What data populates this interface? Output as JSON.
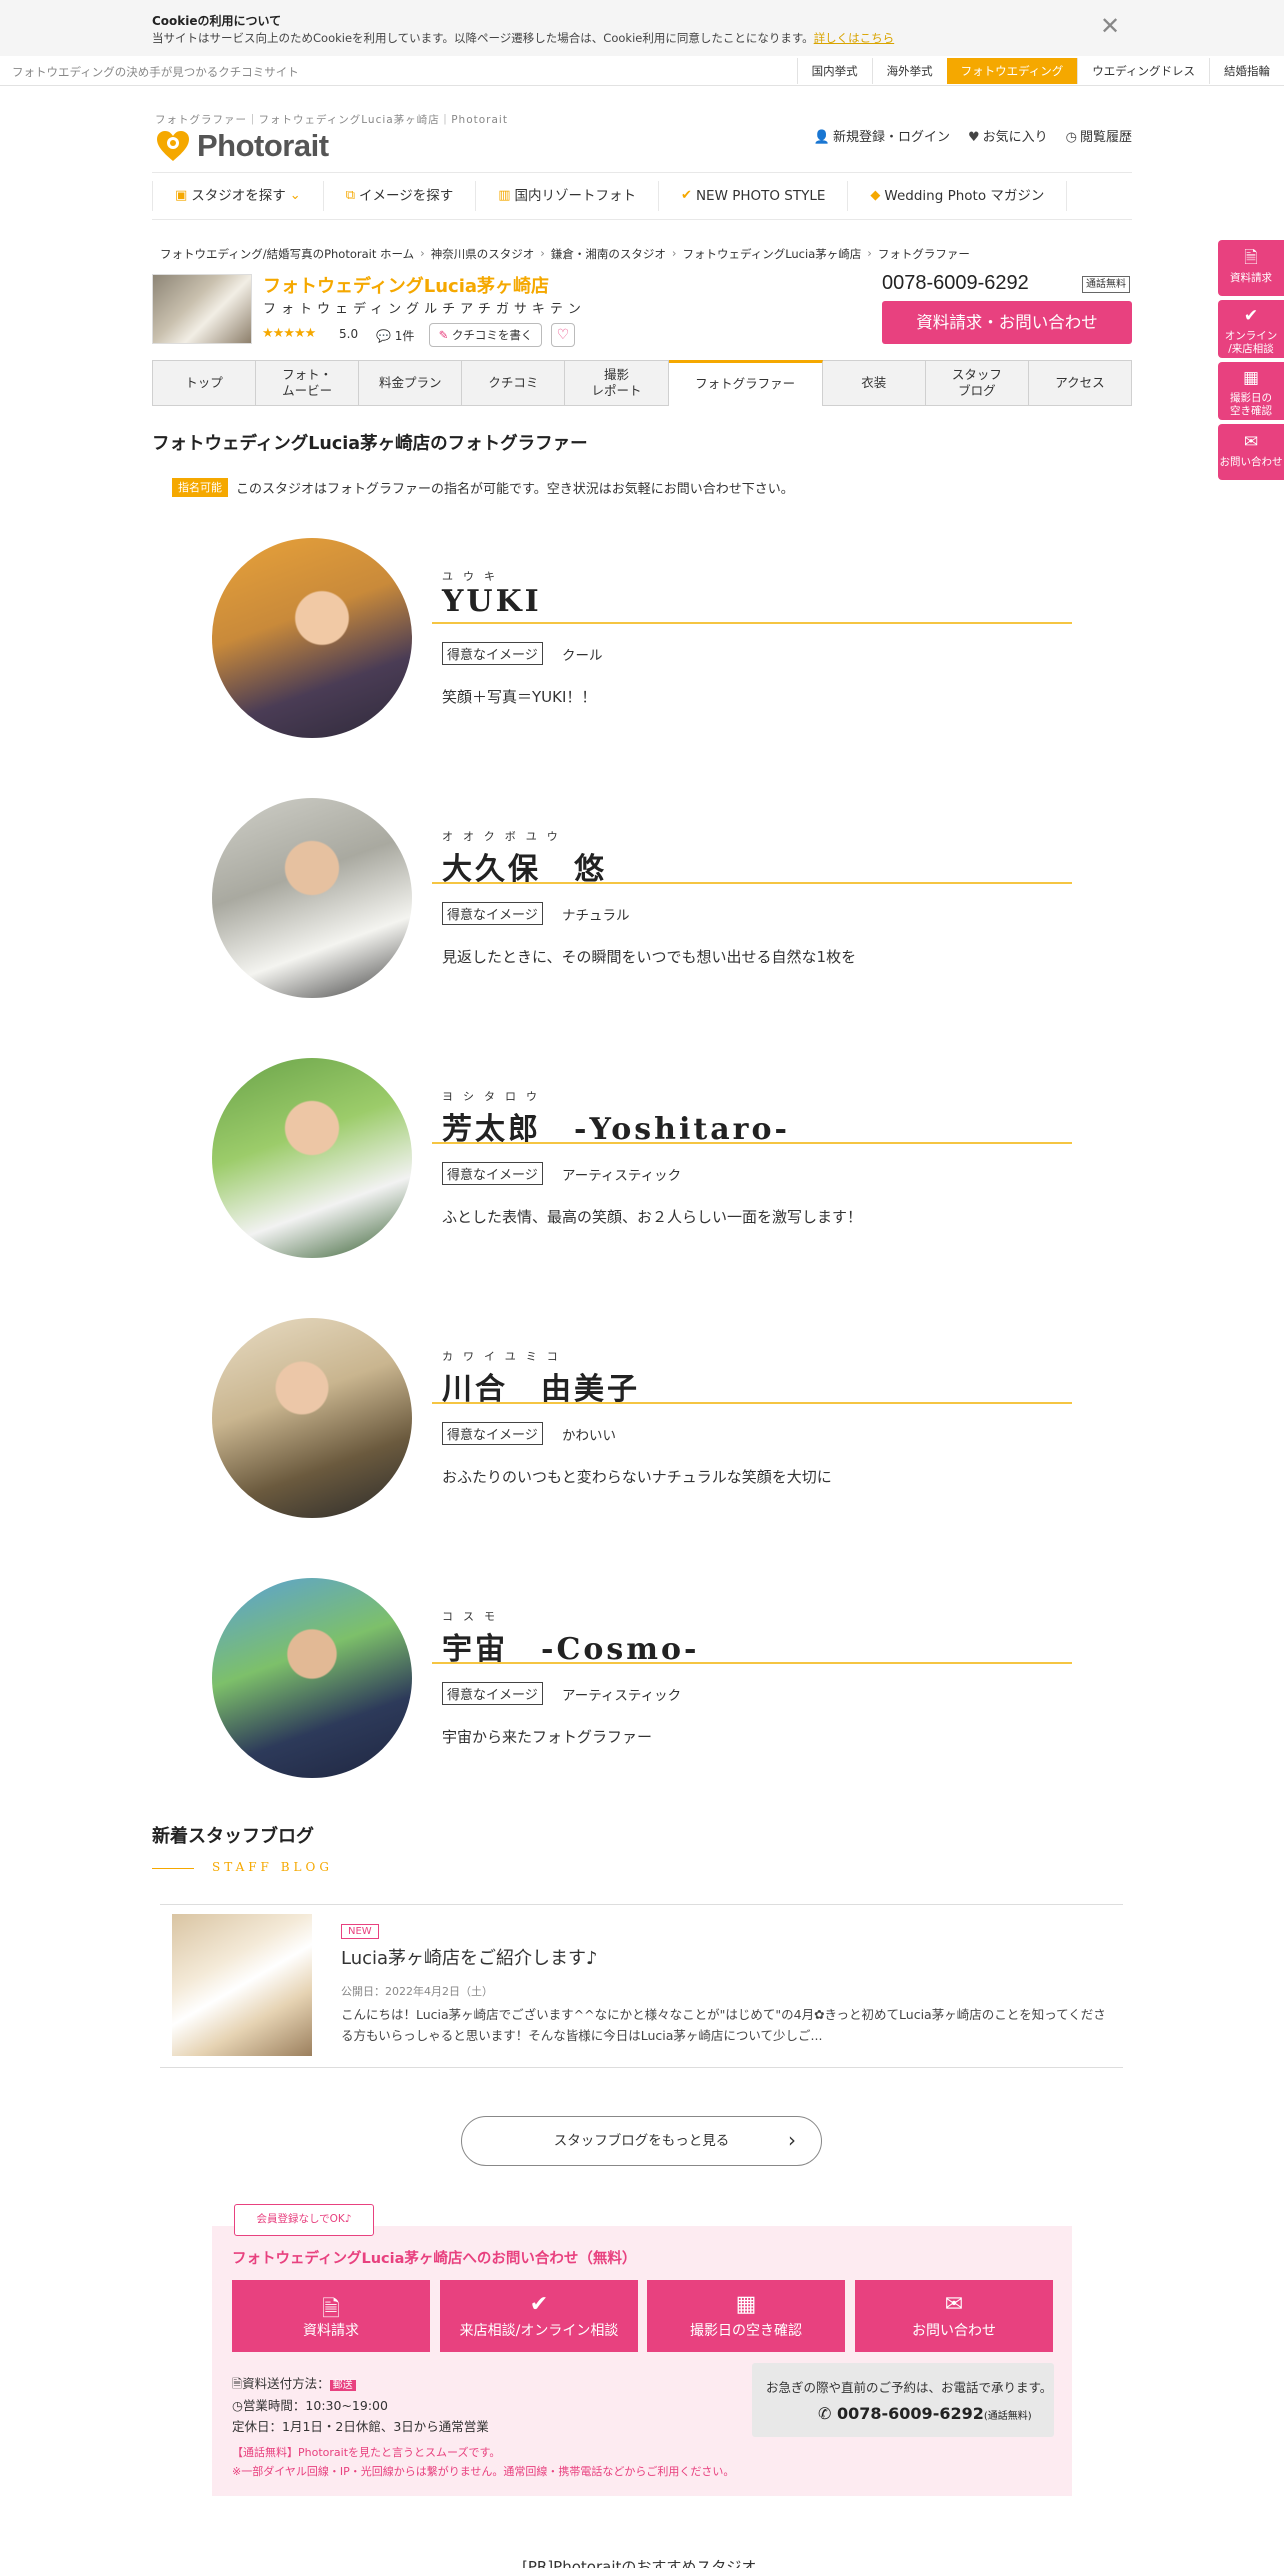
{
  "cookie": {
    "title": "Cookieの利用について",
    "text": "当サイトはサービス向上のためCookieを利用しています。以降ページ遷移した場合は、Cookie利用に同意したことになります。",
    "link": "詳しくはこちら",
    "close": "✕"
  },
  "sitebar": {
    "tagline": "フォトウエディングの決め手が見つかるクチコミサイト",
    "links": [
      "国内挙式",
      "海外挙式",
      "フォトウエディング",
      "ウエディングドレス",
      "結婚指輪"
    ]
  },
  "header": {
    "breadcrumb": "フォトグラファー｜フォトウェディングLucia茅ヶ崎店｜Photorait",
    "logo": "Photorait",
    "links": [
      "新規登録・ログイン",
      "お気に入り",
      "閲覧履歴"
    ]
  },
  "gnav": [
    "スタジオを探す",
    "イメージを探す",
    "国内リゾートフォト",
    "NEW PHOTO STYLE",
    "Wedding Photo マガジン"
  ],
  "breadcrumb": [
    "フォトウエディング/結婚写真のPhotorait ホーム",
    "神奈川県のスタジオ",
    "鎌倉・湘南のスタジオ",
    "フォトウェディングLucia茅ヶ崎店",
    "フォトグラファー"
  ],
  "studio": {
    "name": "フォトウェディングLucia茅ヶ崎店",
    "kana": "フォトウェディングルチアチガサキテン",
    "stars": "★★★★★",
    "score": "5.0",
    "reviews": "1件",
    "write_review": "クチコミを書く",
    "phone": "0078-6009-6292",
    "free_badge": "通話無料",
    "contact_button": "資料請求・お問い合わせ"
  },
  "tabs": [
    "トップ",
    "フォト・\nムービー",
    "料金プラン",
    "クチコミ",
    "撮影\nレポート",
    "フォトグラファー",
    "衣装",
    "スタッフ\nブログ",
    "アクセス"
  ],
  "page": {
    "title": "フォトウェディングLucia茅ヶ崎店のフォトグラファー",
    "nominate_badge": "指名可能",
    "nominate_text": "このスタジオはフォトグラファーの指名が可能です。空き状況はお気軽にお問い合わせ下さい。",
    "tag_label": "得意なイメージ"
  },
  "photographers": [
    {
      "kana": "ユウキ",
      "name": "YUKI",
      "tag": "クール",
      "desc": "笑顔＋写真＝YUKI！！"
    },
    {
      "kana": "オオクボユウ",
      "name": "大久保　悠",
      "tag": "ナチュラル",
      "desc": "見返したときに、その瞬間をいつでも想い出せる自然な1枚を"
    },
    {
      "kana": "ヨシタロウ",
      "name": "芳太郎　-Yoshitaro-",
      "tag": "アーティスティック",
      "desc": "ふとした表情、最高の笑顔、お２人らしい一面を激写します！"
    },
    {
      "kana": "カワイユミコ",
      "name": "川合　由美子",
      "tag": "かわいい",
      "desc": "おふたりのいつもと変わらないナチュラルな笑顔を大切に"
    },
    {
      "kana": "コスモ",
      "name": "宇宙　-Cosmo-",
      "tag": "アーティスティック",
      "desc": "宇宙から来たフォトグラファー"
    }
  ],
  "blog": {
    "title": "新着スタッフブログ",
    "subtitle": "STAFF BLOG",
    "new_badge": "NEW",
    "post_title": "Lucia茅ヶ崎店をご紹介します♪",
    "date": "公開日：2022年4月2日（土）",
    "excerpt": "こんにちは！Lucia茅ヶ崎店でございます^^なにかと様々なことが\"はじめて\"の4月✿きっと初めてLucia茅ヶ崎店のことを知ってくださる方もいらっしゃると思います！そんな皆様に今日はLucia茅ヶ崎店について少しご...",
    "more": "スタッフブログをもっと見る"
  },
  "contact": {
    "member_tag": "会員登録なしでOK♪",
    "heading": "フォトウェディングLucia茅ヶ崎店へのお問い合わせ（無料）",
    "buttons": [
      "資料請求",
      "来店相談/オンライン相談",
      "撮影日の空き確認",
      "お問い合わせ"
    ],
    "send_method": "資料送付方法：",
    "send_badge": "郵送",
    "hours": "営業時間：10:30~19:00",
    "holidays": "定休日：1月1日・2日休館、3日から通常営業",
    "phone_text": "お急ぎの際や直前のご予約は、お電話で承ります。",
    "phone": "0078-6009-6292",
    "phone_free": "(通話無料)",
    "note1": "【通話無料】Photoraitを見たと言うとスムーズです。",
    "note2": "※一部ダイヤル回線・IP・光回線からは繋がりません。通常回線・携帯電話などからご利用ください。"
  },
  "pr_title": "[PR]Photoraitのおすすめスタジオ",
  "side": [
    "資料請求",
    "オンライン\n/来店相談",
    "撮影日の\n空き確認",
    "お問い合わせ"
  ],
  "colors": {
    "accent": "#f5a800",
    "pink": "#e8417f"
  }
}
